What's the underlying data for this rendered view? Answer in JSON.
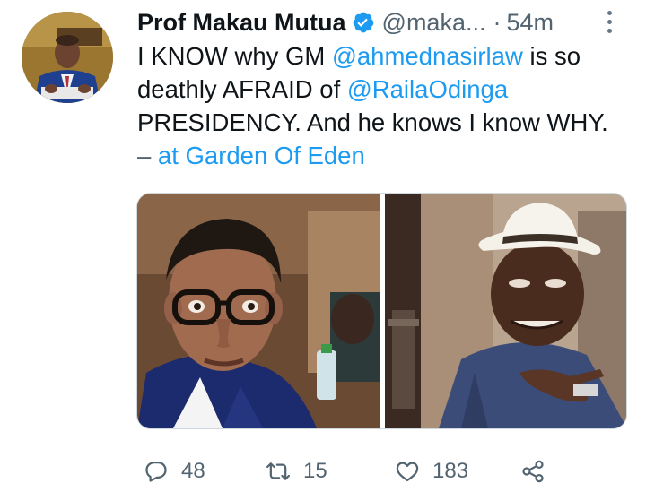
{
  "tweet": {
    "display_name": "Prof Makau Mutua",
    "handle": "@maka...",
    "separator": "·",
    "time": "54m",
    "text": {
      "part1": "I KNOW why GM ",
      "mention1": "@ahmednasirlaw",
      "part2": " is so deathly AFRAID of ",
      "mention2": "@RailaOdinga",
      "part3": " PRESIDENCY.  And he knows I know WHY. ",
      "dash": "–",
      "place": " at Garden Of Eden"
    },
    "media": [
      {
        "icon": "photo-man-glasses"
      },
      {
        "icon": "photo-man-hat"
      }
    ]
  },
  "actions": {
    "reply_count": "48",
    "retweet_count": "15",
    "like_count": "183"
  },
  "colors": {
    "accent": "#1d9bf0",
    "secondary_text": "#536471",
    "primary_text": "#0f1419"
  }
}
